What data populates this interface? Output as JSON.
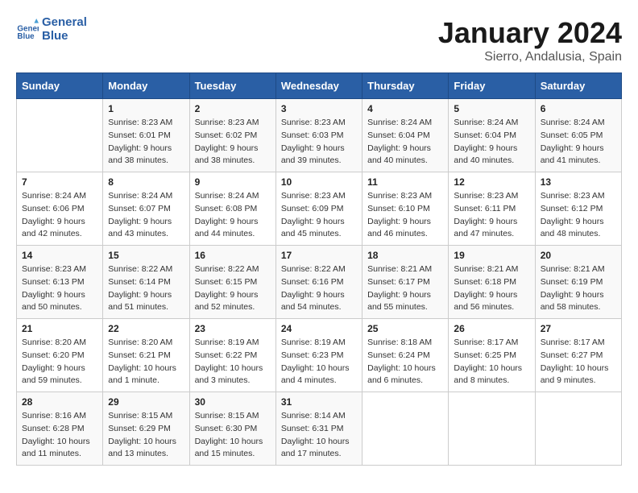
{
  "logo": {
    "line1": "General",
    "line2": "Blue"
  },
  "title": "January 2024",
  "subtitle": "Sierro, Andalusia, Spain",
  "days_of_week": [
    "Sunday",
    "Monday",
    "Tuesday",
    "Wednesday",
    "Thursday",
    "Friday",
    "Saturday"
  ],
  "weeks": [
    [
      {
        "day": "",
        "sunrise": "",
        "sunset": "",
        "daylight": ""
      },
      {
        "day": "1",
        "sunrise": "8:23 AM",
        "sunset": "6:01 PM",
        "daylight": "9 hours and 38 minutes."
      },
      {
        "day": "2",
        "sunrise": "8:23 AM",
        "sunset": "6:02 PM",
        "daylight": "9 hours and 38 minutes."
      },
      {
        "day": "3",
        "sunrise": "8:23 AM",
        "sunset": "6:03 PM",
        "daylight": "9 hours and 39 minutes."
      },
      {
        "day": "4",
        "sunrise": "8:24 AM",
        "sunset": "6:04 PM",
        "daylight": "9 hours and 40 minutes."
      },
      {
        "day": "5",
        "sunrise": "8:24 AM",
        "sunset": "6:04 PM",
        "daylight": "9 hours and 40 minutes."
      },
      {
        "day": "6",
        "sunrise": "8:24 AM",
        "sunset": "6:05 PM",
        "daylight": "9 hours and 41 minutes."
      }
    ],
    [
      {
        "day": "7",
        "sunrise": "8:24 AM",
        "sunset": "6:06 PM",
        "daylight": "9 hours and 42 minutes."
      },
      {
        "day": "8",
        "sunrise": "8:24 AM",
        "sunset": "6:07 PM",
        "daylight": "9 hours and 43 minutes."
      },
      {
        "day": "9",
        "sunrise": "8:24 AM",
        "sunset": "6:08 PM",
        "daylight": "9 hours and 44 minutes."
      },
      {
        "day": "10",
        "sunrise": "8:23 AM",
        "sunset": "6:09 PM",
        "daylight": "9 hours and 45 minutes."
      },
      {
        "day": "11",
        "sunrise": "8:23 AM",
        "sunset": "6:10 PM",
        "daylight": "9 hours and 46 minutes."
      },
      {
        "day": "12",
        "sunrise": "8:23 AM",
        "sunset": "6:11 PM",
        "daylight": "9 hours and 47 minutes."
      },
      {
        "day": "13",
        "sunrise": "8:23 AM",
        "sunset": "6:12 PM",
        "daylight": "9 hours and 48 minutes."
      }
    ],
    [
      {
        "day": "14",
        "sunrise": "8:23 AM",
        "sunset": "6:13 PM",
        "daylight": "9 hours and 50 minutes."
      },
      {
        "day": "15",
        "sunrise": "8:22 AM",
        "sunset": "6:14 PM",
        "daylight": "9 hours and 51 minutes."
      },
      {
        "day": "16",
        "sunrise": "8:22 AM",
        "sunset": "6:15 PM",
        "daylight": "9 hours and 52 minutes."
      },
      {
        "day": "17",
        "sunrise": "8:22 AM",
        "sunset": "6:16 PM",
        "daylight": "9 hours and 54 minutes."
      },
      {
        "day": "18",
        "sunrise": "8:21 AM",
        "sunset": "6:17 PM",
        "daylight": "9 hours and 55 minutes."
      },
      {
        "day": "19",
        "sunrise": "8:21 AM",
        "sunset": "6:18 PM",
        "daylight": "9 hours and 56 minutes."
      },
      {
        "day": "20",
        "sunrise": "8:21 AM",
        "sunset": "6:19 PM",
        "daylight": "9 hours and 58 minutes."
      }
    ],
    [
      {
        "day": "21",
        "sunrise": "8:20 AM",
        "sunset": "6:20 PM",
        "daylight": "9 hours and 59 minutes."
      },
      {
        "day": "22",
        "sunrise": "8:20 AM",
        "sunset": "6:21 PM",
        "daylight": "10 hours and 1 minute."
      },
      {
        "day": "23",
        "sunrise": "8:19 AM",
        "sunset": "6:22 PM",
        "daylight": "10 hours and 3 minutes."
      },
      {
        "day": "24",
        "sunrise": "8:19 AM",
        "sunset": "6:23 PM",
        "daylight": "10 hours and 4 minutes."
      },
      {
        "day": "25",
        "sunrise": "8:18 AM",
        "sunset": "6:24 PM",
        "daylight": "10 hours and 6 minutes."
      },
      {
        "day": "26",
        "sunrise": "8:17 AM",
        "sunset": "6:25 PM",
        "daylight": "10 hours and 8 minutes."
      },
      {
        "day": "27",
        "sunrise": "8:17 AM",
        "sunset": "6:27 PM",
        "daylight": "10 hours and 9 minutes."
      }
    ],
    [
      {
        "day": "28",
        "sunrise": "8:16 AM",
        "sunset": "6:28 PM",
        "daylight": "10 hours and 11 minutes."
      },
      {
        "day": "29",
        "sunrise": "8:15 AM",
        "sunset": "6:29 PM",
        "daylight": "10 hours and 13 minutes."
      },
      {
        "day": "30",
        "sunrise": "8:15 AM",
        "sunset": "6:30 PM",
        "daylight": "10 hours and 15 minutes."
      },
      {
        "day": "31",
        "sunrise": "8:14 AM",
        "sunset": "6:31 PM",
        "daylight": "10 hours and 17 minutes."
      },
      {
        "day": "",
        "sunrise": "",
        "sunset": "",
        "daylight": ""
      },
      {
        "day": "",
        "sunrise": "",
        "sunset": "",
        "daylight": ""
      },
      {
        "day": "",
        "sunrise": "",
        "sunset": "",
        "daylight": ""
      }
    ]
  ]
}
